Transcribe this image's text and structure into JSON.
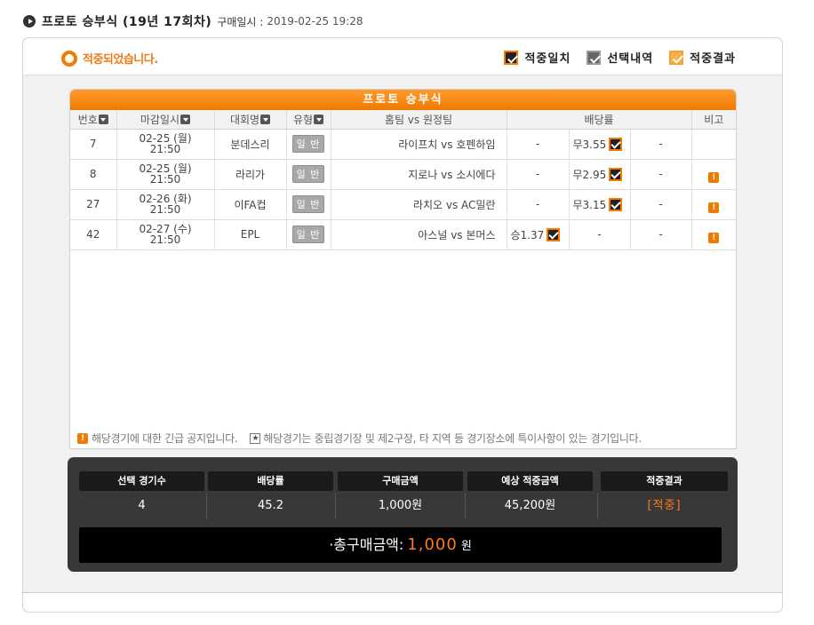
{
  "header": {
    "title": "프로토 승부식 (19년 17회차)",
    "purchase_label": "구매일시 :",
    "purchase_datetime": "2019-02-25 19:28"
  },
  "status": {
    "text": "적중되었습니다."
  },
  "legend": {
    "match": "적중일치",
    "selection": "선택내역",
    "result": "적중결과",
    "colors": {
      "match": "#f57a00",
      "selection": "#666666",
      "result": "#f8b04b"
    }
  },
  "table": {
    "title": "프로토 승부식",
    "columns": {
      "number": "번호",
      "deadline": "마감일시",
      "league": "대회명",
      "type": "유형",
      "teams": "홈팀 vs 원정팀",
      "odds": "배당률",
      "note": "비고"
    },
    "rows": [
      {
        "number": "7",
        "date": "02-25 (월)",
        "time": "21:50",
        "league": "분데스리",
        "type": "일 반",
        "teams": "라이프치 vs 호펜하임",
        "odds_win": "-",
        "odds_draw": "무3.55",
        "odds_lose": "-",
        "alert": ""
      },
      {
        "number": "8",
        "date": "02-25 (월)",
        "time": "21:50",
        "league": "라리가",
        "type": "일 반",
        "teams": "지로나 vs 소시에다",
        "odds_win": "-",
        "odds_draw": "무2.95",
        "odds_lose": "-",
        "alert": "!"
      },
      {
        "number": "27",
        "date": "02-26 (화)",
        "time": "21:50",
        "league": "이FA컵",
        "type": "일 반",
        "teams": "라치오 vs AC밀란",
        "odds_win": "-",
        "odds_draw": "무3.15",
        "odds_lose": "-",
        "alert": "!"
      },
      {
        "number": "42",
        "date": "02-27 (수)",
        "time": "21:50",
        "league": "EPL",
        "type": "일 반",
        "teams": "아스널 vs 본머스",
        "odds_win": "승1.37",
        "odds_draw": "-",
        "odds_lose": "-",
        "alert": "!"
      }
    ]
  },
  "notice": {
    "urgent": "해당경기에 대한 긴급 공지입니다.",
    "special": "해당경기는 중립경기장 및 제2구장, 타 지역 등 경기장소에 특이사항이 있는 경기입니다.",
    "alert_glyph": "!",
    "star_glyph": "★"
  },
  "summary": {
    "headers": {
      "games": "선택 경기수",
      "odds": "배당률",
      "amount": "구매금액",
      "expected": "예상 적중금액",
      "result": "적중결과"
    },
    "values": {
      "games": "4",
      "odds": "45.2",
      "amount": "1,000원",
      "expected": "45,200원",
      "result": "[적중]"
    },
    "total_label": "·총구매금액:",
    "total_amount": "1,000",
    "total_unit": "원"
  }
}
